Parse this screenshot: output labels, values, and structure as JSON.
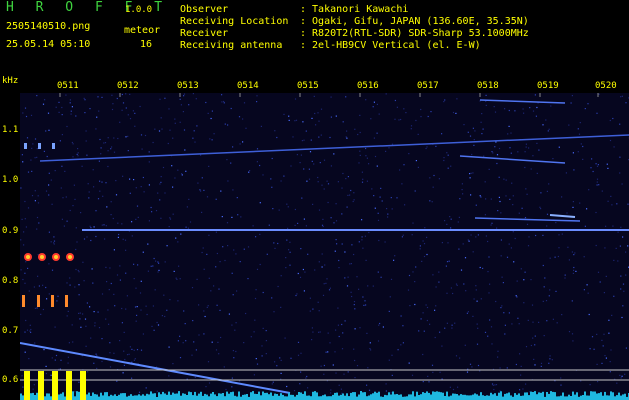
{
  "app": {
    "logo": "H R O F F T",
    "version": "1.0.0"
  },
  "capture": {
    "filename": "2505140510.png",
    "datetime": "25.05.14 05:10"
  },
  "meteor": {
    "label": "meteor",
    "count": "16"
  },
  "info": [
    {
      "label": "Observer",
      "value": ": Takanori Kawachi"
    },
    {
      "label": "Receiving Location",
      "value": ": Ogaki, Gifu, JAPAN (136.60E, 35.35N)"
    },
    {
      "label": "Receiver",
      "value": ": R820T2(RTL-SDR) SDR-Sharp 53.1000MHz"
    },
    {
      "label": "Receiving antenna",
      "value": ": 2el-HB9CV Vertical (el. E-W)"
    }
  ],
  "axis": {
    "y_unit": "kHz",
    "y_ticks": [
      "1.1",
      "1.0",
      "0.9",
      "0.8",
      "0.7",
      "0.6"
    ],
    "x_ticks": [
      "0511",
      "0512",
      "0513",
      "0514",
      "0515",
      "0516",
      "0517",
      "0518",
      "0519",
      "0520"
    ]
  },
  "colors": {
    "background": "#06061f",
    "text_yellow": "#ffff00",
    "logo_green": "#3fd43f",
    "signal": "#4a7dff",
    "histogram": "#ffff00"
  }
}
